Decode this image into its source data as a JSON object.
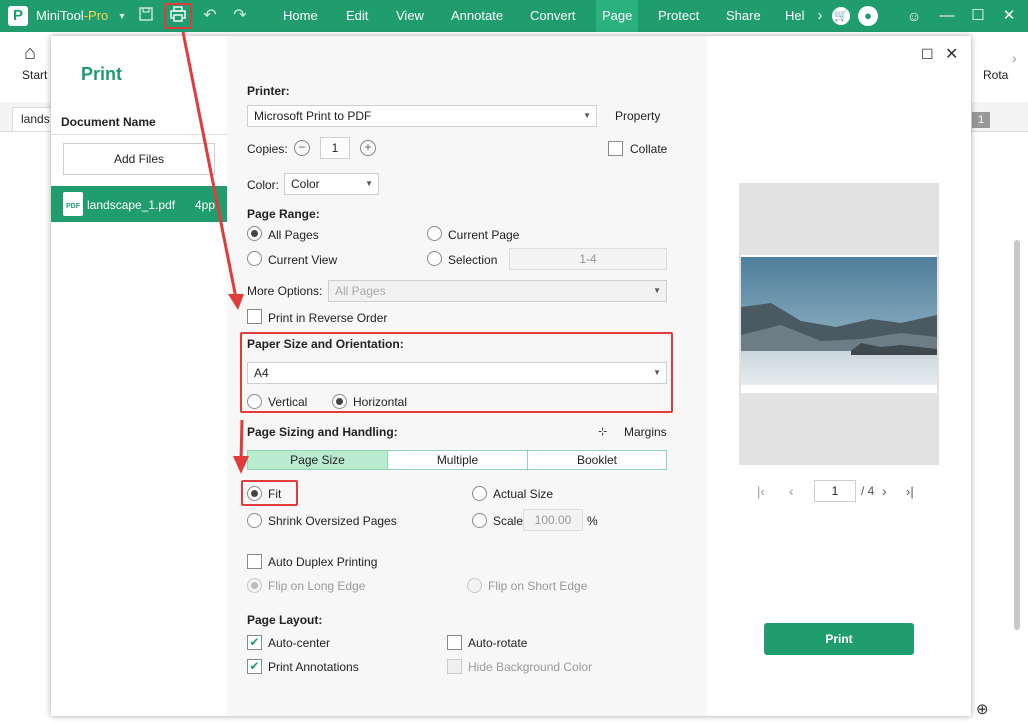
{
  "app": {
    "name_main": "MiniTool",
    "name_suffix": "-Pro",
    "logo": "P"
  },
  "menu": [
    "Home",
    "Edit",
    "View",
    "Annotate",
    "Convert",
    "Page",
    "Protect",
    "Share",
    "Hel"
  ],
  "menu_active": "Page",
  "ribbon": {
    "start": "Start",
    "rotate": "Rota"
  },
  "doc_tab": {
    "label": "lands",
    "page_badge": "1"
  },
  "dialog": {
    "title": "Print",
    "document_name_header": "Document Name",
    "add_files": "Add Files",
    "file": {
      "name": "landscape_1.pdf",
      "pages": "4pp"
    },
    "printer_label": "Printer:",
    "printer_value": "Microsoft Print to PDF",
    "property": "Property",
    "copies_label": "Copies:",
    "copies_value": "1",
    "collate": "Collate",
    "color_label": "Color:",
    "color_value": "Color",
    "page_range_label": "Page Range:",
    "all_pages": "All Pages",
    "current_page": "Current Page",
    "current_view": "Current View",
    "selection": "Selection",
    "selection_placeholder": "1-4",
    "more_options_label": "More Options:",
    "more_options_value": "All Pages",
    "reverse_order": "Print in Reverse Order",
    "paper_label": "Paper Size and Orientation:",
    "paper_value": "A4",
    "vertical": "Vertical",
    "horizontal": "Horizontal",
    "sizing_label": "Page Sizing and Handling:",
    "margins": "Margins",
    "sizing_tabs": [
      "Page Size",
      "Multiple",
      "Booklet"
    ],
    "fit": "Fit",
    "actual_size": "Actual Size",
    "shrink": "Shrink Oversized Pages",
    "scale": "Scale",
    "scale_value": "100.00",
    "scale_unit": "%",
    "auto_duplex": "Auto Duplex Printing",
    "flip_long": "Flip on Long Edge",
    "flip_short": "Flip on Short Edge",
    "layout_label": "Page Layout:",
    "auto_center": "Auto-center",
    "auto_rotate": "Auto-rotate",
    "print_annotations": "Print Annotations",
    "hide_bg": "Hide Background Color",
    "preview_page": "1",
    "preview_total": "/ 4",
    "print_button": "Print"
  },
  "colors": {
    "brand": "#1f9d6e",
    "highlight": "#e23b3b",
    "print_button": "#1f9d6e"
  }
}
